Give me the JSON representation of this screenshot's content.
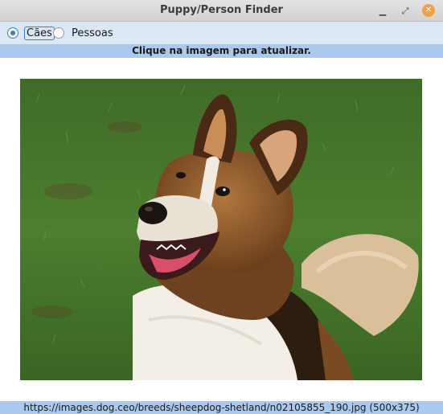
{
  "window": {
    "title": "Puppy/Person Finder",
    "minimize_icon": "minimize-icon",
    "maximize_icon": "maximize-icon",
    "close_icon": "close-icon"
  },
  "toolbar": {
    "options": [
      {
        "label": "Cães",
        "selected": true
      },
      {
        "label": "Pessoas",
        "selected": false
      }
    ]
  },
  "info": {
    "text": "Clique na imagem para atualizar."
  },
  "image": {
    "description_icon": "dog-photo",
    "url_text": "https://images.dog.ceo/breeds/sheepdog-shetland/n02105855_190.jpg (500x375)"
  },
  "colors": {
    "toolbar_bg": "#dce7f5",
    "infobar_bg": "#a9c9ee",
    "radio_accent": "#3d7cc4",
    "close_button": "#f0a04a"
  }
}
